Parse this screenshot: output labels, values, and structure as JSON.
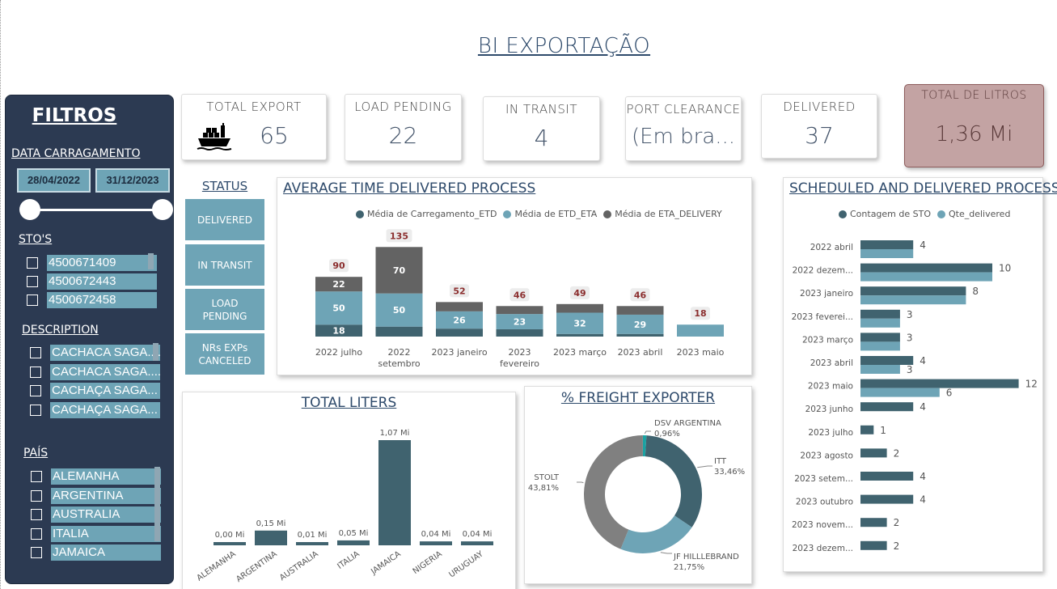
{
  "page": {
    "title": "BI EXPORTAÇÃO"
  },
  "colors": {
    "dark": "#40636f",
    "teal": "#6ea4b6",
    "grey": "#636363",
    "panel": "#2c3a52",
    "litros_bg": "#c3a3a3"
  },
  "filters": {
    "title": "FILTROS",
    "date_label": "DATA CARRAGAMENTO",
    "date_start": "28/04/2022",
    "date_end": "31/12/2023",
    "sto_label": "STO'S",
    "sto_items": [
      "4500671409",
      "4500672443",
      "4500672458"
    ],
    "description_label": "DESCRIPTION",
    "description_items": [
      "CACHACA SAGA....",
      "CACHACA SAGA....",
      "CACHAÇA SAGA...",
      "CACHAÇA SAGA..."
    ],
    "pais_label": "PAÍS",
    "pais_items": [
      "ALEMANHA",
      "ARGENTINA",
      "AUSTRALIA",
      "ITALIA",
      "JAMAICA"
    ]
  },
  "kpis": {
    "total_export": {
      "label": "TOTAL EXPORT",
      "value": "65",
      "icon": "cargo-ship-icon"
    },
    "load_pending": {
      "label": "LOAD PENDING",
      "value": "22"
    },
    "in_transit": {
      "label": "IN TRANSIT",
      "value": "4"
    },
    "port_clearance": {
      "label": "PORT CLEARANCE",
      "value": "(Em bra..."
    },
    "delivered": {
      "label": "DELIVERED",
      "value": "37"
    },
    "total_litros": {
      "label": "TOTAL DE LITROS",
      "value": "1,36 Mi"
    }
  },
  "status": {
    "title": "STATUS",
    "buttons": [
      "DELIVERED",
      "IN TRANSIT",
      "LOAD\nPENDING",
      "NRs EXPs\nCANCELED"
    ]
  },
  "chart_data": [
    {
      "id": "avg_time",
      "type": "bar",
      "stacked": true,
      "title": "AVERAGE TIME DELIVERED PROCESS",
      "categories": [
        "2022 julho",
        "2022 setembro",
        "2023 janeiro",
        "2023 fevereiro",
        "2023 março",
        "2023 abril",
        "2023 maio"
      ],
      "series": [
        {
          "name": "Média de Carregamento_ETD",
          "values": [
            18,
            15,
            12,
            11,
            4,
            4,
            0
          ]
        },
        {
          "name": "Média de ETD_ETA",
          "values": [
            50,
            50,
            26,
            23,
            32,
            29,
            18
          ]
        },
        {
          "name": "Média de ETA_DELIVERY",
          "values": [
            22,
            70,
            14,
            12,
            13,
            13,
            0
          ]
        }
      ],
      "segment_labels": [
        [
          "18",
          "50",
          "22"
        ],
        [
          "",
          "50",
          "70"
        ],
        [
          "",
          "26",
          ""
        ],
        [
          "",
          "23",
          ""
        ],
        [
          "",
          "32",
          ""
        ],
        [
          "",
          "29",
          ""
        ],
        [
          "",
          "",
          ""
        ]
      ],
      "totals": [
        "90",
        "135",
        "52",
        "46",
        "49",
        "46",
        "18"
      ],
      "legend_position": "top"
    },
    {
      "id": "total_liters",
      "type": "bar",
      "title": "TOTAL LITERS",
      "categories": [
        "ALEMANHA",
        "ARGENTINA",
        "AUSTRALIA",
        "ITALIA",
        "JAMAICA",
        "NIGERIA",
        "URUGUAY"
      ],
      "values": [
        0.0,
        0.15,
        0.01,
        0.05,
        1.07,
        0.04,
        0.04
      ],
      "value_labels": [
        "0,00 Mi",
        "0,15 Mi",
        "0,01 Mi",
        "0,05 Mi",
        "1,07 Mi",
        "0,04 Mi",
        "0,04 Mi"
      ]
    },
    {
      "id": "freight",
      "type": "pie",
      "donut": true,
      "title": "% FREIGHT EXPORTER",
      "slices": [
        {
          "name": "DSV ARGENTINA",
          "pct": 0.96,
          "label": "0,96%",
          "color": "#1aa3a3"
        },
        {
          "name": "ITT",
          "pct": 33.46,
          "label": "33,46%",
          "color": "#40636f"
        },
        {
          "name": "JF HILLLEBRAND",
          "pct": 21.75,
          "label": "21,75%",
          "color": "#6ea4b6"
        },
        {
          "name": "STOLT",
          "pct": 43.81,
          "label": "43,81%",
          "color": "#808080"
        }
      ]
    },
    {
      "id": "scheduled",
      "type": "bar",
      "orientation": "horizontal",
      "title": "SCHEDULED AND DELIVERED PROCESS",
      "categories": [
        "2022 abril",
        "2022 dezem...",
        "2023 janeiro",
        "2023 feverei...",
        "2023 março",
        "2023 abril",
        "2023 maio",
        "2023 junho",
        "2023 julho",
        "2023 agosto",
        "2023 setem...",
        "2023 outubro",
        "2023 novem...",
        "2023 dezem..."
      ],
      "series": [
        {
          "name": "Contagem de STO",
          "values": [
            4,
            10,
            8,
            3,
            3,
            4,
            12,
            4,
            1,
            2,
            4,
            4,
            2,
            2
          ]
        },
        {
          "name": "Qte_delivered",
          "values": [
            4,
            10,
            8,
            3,
            3,
            3,
            6,
            null,
            null,
            null,
            null,
            null,
            null,
            null
          ]
        }
      ],
      "point_labels": [
        "4",
        "10",
        "8",
        "3",
        "3",
        "4",
        "12",
        "4",
        "1",
        "2",
        "4",
        "4",
        "2",
        "2"
      ],
      "extra_labels": {
        "5": "3",
        "6": "6"
      },
      "legend_position": "top"
    }
  ]
}
